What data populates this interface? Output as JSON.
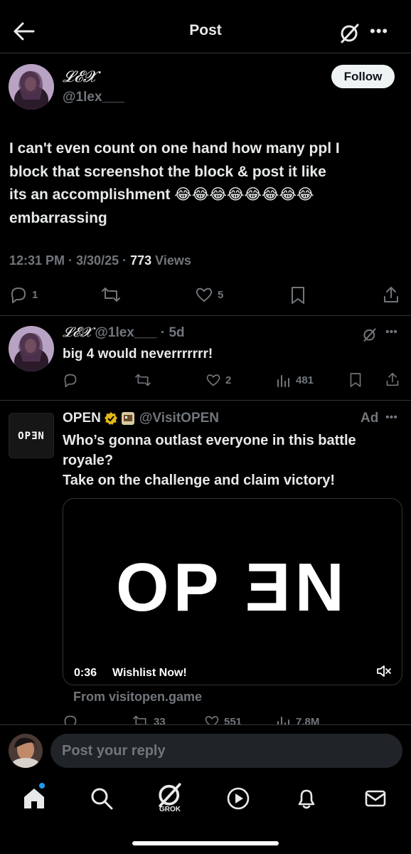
{
  "header": {
    "title": "Post"
  },
  "post": {
    "author_name": "𝓛𝓔𝓧",
    "author_handle": "@1lex___",
    "follow_label": "Follow",
    "text_line1": "I can't even count on one hand how many ppl I",
    "text_line2": "block that screenshot the block & post it like",
    "text_line3": "its an accomplishment 😂😂😂😂😂😂😂😂",
    "text_line4": "embarrassing",
    "time": "12:31 PM · 3/30/25 · ",
    "views_count": "773",
    "views_label": " Views",
    "replies": "1",
    "likes": "5"
  },
  "reply": {
    "author_name": "𝓛𝓔𝓧",
    "author_handle": "@1lex___",
    "age": "· 5d",
    "text": "big 4 would neverrrrrrr!",
    "likes": "2",
    "views": "481"
  },
  "ad": {
    "name": "OPEN",
    "handle": "@VisitOPEN",
    "tag": "Ad",
    "logo_text": "OPƎN",
    "text_line1": "Who’s gonna outlast everyone in this battle",
    "text_line2": "royale?",
    "text_line3": "Take on the challenge and claim victory!",
    "media_word": "OP ƎN",
    "video_time": "0:36",
    "video_cta": "Wishlist Now!",
    "from": "From visitopen.game",
    "retweets": "33",
    "likes": "551",
    "views": "7.8M"
  },
  "composer": {
    "placeholder": "Post your reply"
  },
  "tabs": {
    "grok_label": "GROK"
  },
  "colors": {
    "accent": "#1d9bf0",
    "background": "#000000",
    "muted": "#71767b",
    "text": "#e7e9ea"
  }
}
